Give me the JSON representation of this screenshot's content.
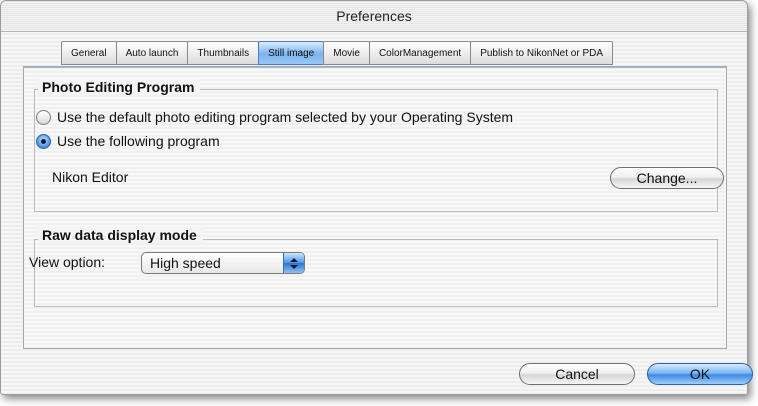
{
  "window": {
    "title": "Preferences"
  },
  "tabs": [
    {
      "label": "General",
      "active": false
    },
    {
      "label": "Auto launch",
      "active": false
    },
    {
      "label": "Thumbnails",
      "active": false
    },
    {
      "label": "Still image",
      "active": true
    },
    {
      "label": "Movie",
      "active": false
    },
    {
      "label": "ColorManagement",
      "active": false
    },
    {
      "label": "Publish to NikonNet or PDA",
      "active": false
    }
  ],
  "photo_editing": {
    "title": "Photo Editing Program",
    "option_default": "Use the default photo editing program selected by your Operating System",
    "option_following": "Use the following program",
    "selected": "following",
    "program_name": "Nikon Editor",
    "change_label": "Change..."
  },
  "raw_display": {
    "title": "Raw data display mode",
    "view_option_label": "View option:",
    "view_option_value": "High speed"
  },
  "footer": {
    "cancel_label": "Cancel",
    "ok_label": "OK"
  },
  "colors": {
    "accent_blue": "#4c93e6",
    "active_tab": "#79b3ee"
  }
}
